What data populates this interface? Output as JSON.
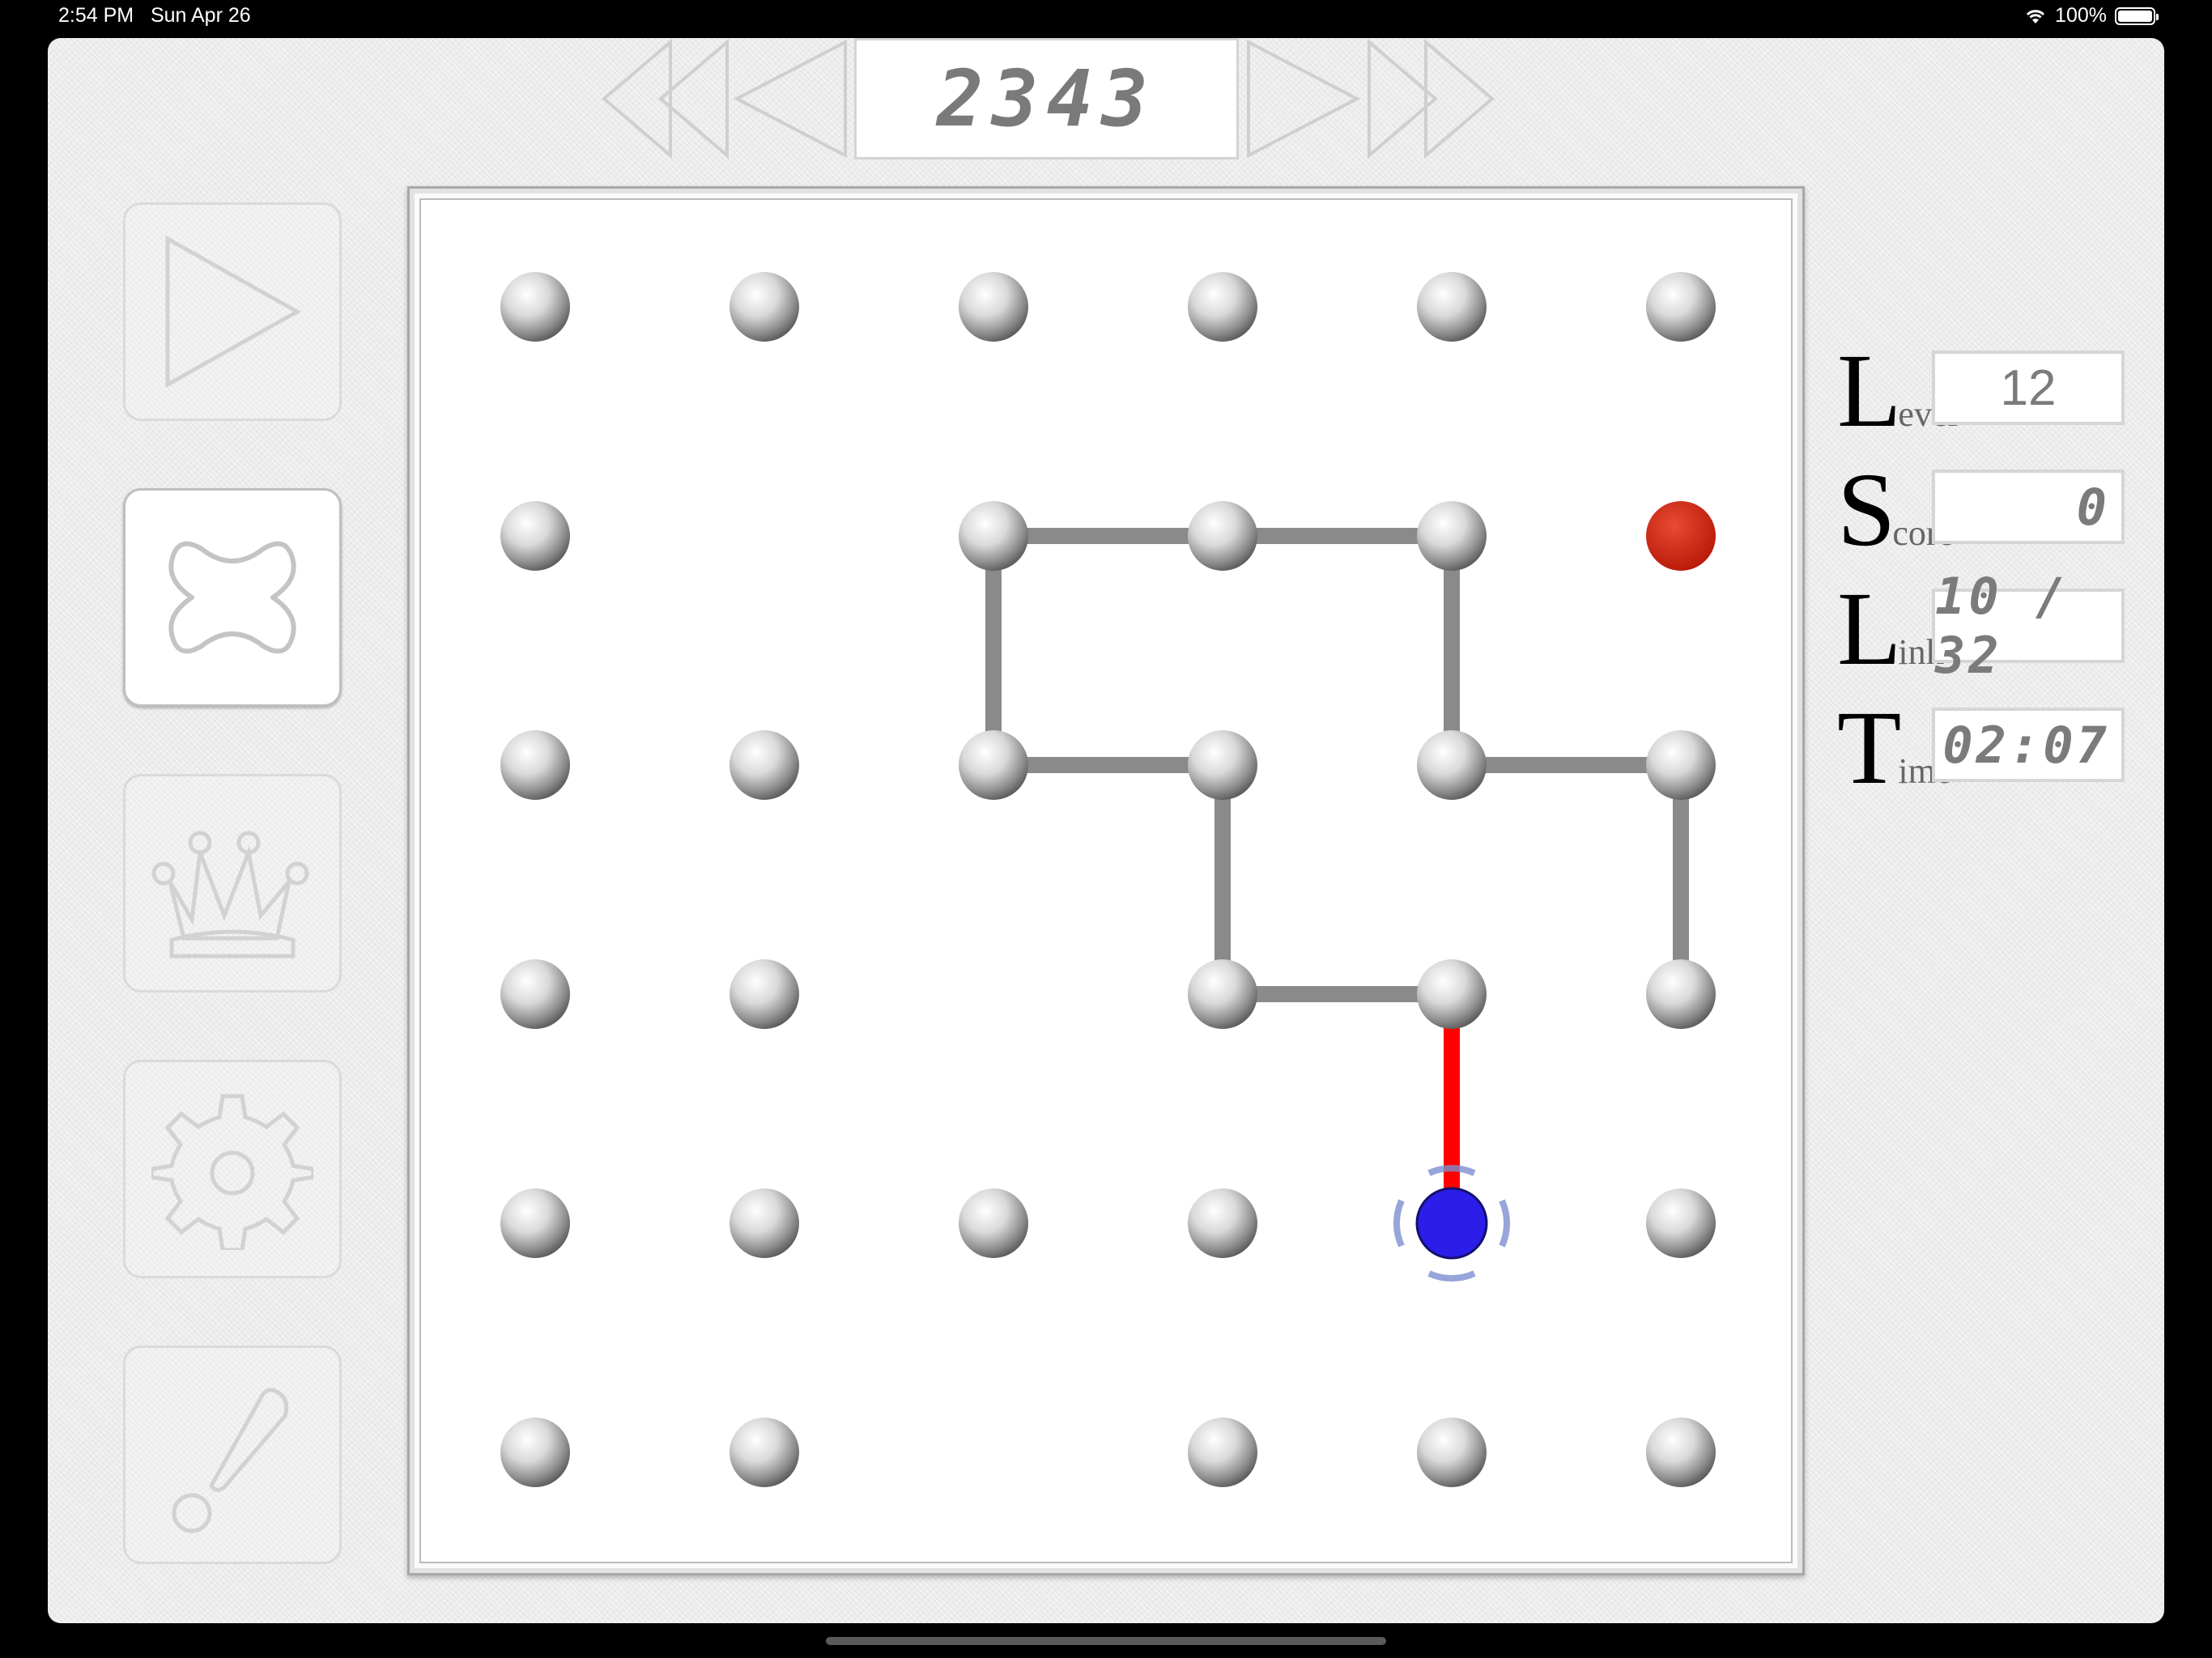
{
  "status_bar": {
    "time": "2:54 PM",
    "date": "Sun Apr 26",
    "battery": "100%"
  },
  "header": {
    "puzzle_number": "2343"
  },
  "stats": {
    "level_label_first": "L",
    "level_label_rest": "evel",
    "level_value": "12",
    "score_label_first": "S",
    "score_label_rest": "core",
    "score_value": "0",
    "link_label_first": "L",
    "link_label_rest": "ink",
    "link_value": "10 / 32",
    "time_label_first": "T",
    "time_label_rest": "ime",
    "time_value": "02:07"
  },
  "side_buttons": [
    {
      "name": "play",
      "icon": "play-icon",
      "active": false
    },
    {
      "name": "clear",
      "icon": "x-icon",
      "active": true
    },
    {
      "name": "leaderboard",
      "icon": "crown-icon",
      "active": false
    },
    {
      "name": "settings",
      "icon": "gear-icon",
      "active": false
    },
    {
      "name": "hint",
      "icon": "exclamation-icon",
      "active": false
    }
  ],
  "colors": {
    "link_gray": "#8a8a8a",
    "active_link_red": "#ff0000",
    "target_red": "#d42010",
    "cursor_blue": "#2a1ee8"
  },
  "game": {
    "grid_cols": 6,
    "grid_rows": 6,
    "dots": [
      [
        0,
        0
      ],
      [
        1,
        0
      ],
      [
        2,
        0
      ],
      [
        3,
        0
      ],
      [
        4,
        0
      ],
      [
        5,
        0
      ],
      [
        0,
        1
      ],
      [
        2,
        1
      ],
      [
        3,
        1
      ],
      [
        4,
        1
      ],
      [
        0,
        2
      ],
      [
        1,
        2
      ],
      [
        2,
        2
      ],
      [
        3,
        2
      ],
      [
        4,
        2
      ],
      [
        5,
        2
      ],
      [
        0,
        3
      ],
      [
        1,
        3
      ],
      [
        3,
        3
      ],
      [
        4,
        3
      ],
      [
        5,
        3
      ],
      [
        0,
        4
      ],
      [
        1,
        4
      ],
      [
        2,
        4
      ],
      [
        3,
        4
      ],
      [
        5,
        4
      ],
      [
        0,
        5
      ],
      [
        1,
        5
      ],
      [
        3,
        5
      ],
      [
        4,
        5
      ],
      [
        5,
        5
      ]
    ],
    "links": [
      [
        [
          2,
          1
        ],
        [
          3,
          1
        ]
      ],
      [
        [
          3,
          1
        ],
        [
          4,
          1
        ]
      ],
      [
        [
          2,
          1
        ],
        [
          2,
          2
        ]
      ],
      [
        [
          2,
          2
        ],
        [
          3,
          2
        ]
      ],
      [
        [
          3,
          2
        ],
        [
          3,
          3
        ]
      ],
      [
        [
          3,
          3
        ],
        [
          4,
          3
        ]
      ],
      [
        [
          4,
          1
        ],
        [
          4,
          2
        ]
      ],
      [
        [
          4,
          2
        ],
        [
          5,
          2
        ]
      ],
      [
        [
          5,
          2
        ],
        [
          5,
          3
        ]
      ]
    ],
    "active_link": [
      [
        4,
        3
      ],
      [
        4,
        4
      ]
    ],
    "target_dot": [
      5,
      1
    ],
    "cursor_dot": [
      4,
      4
    ]
  }
}
